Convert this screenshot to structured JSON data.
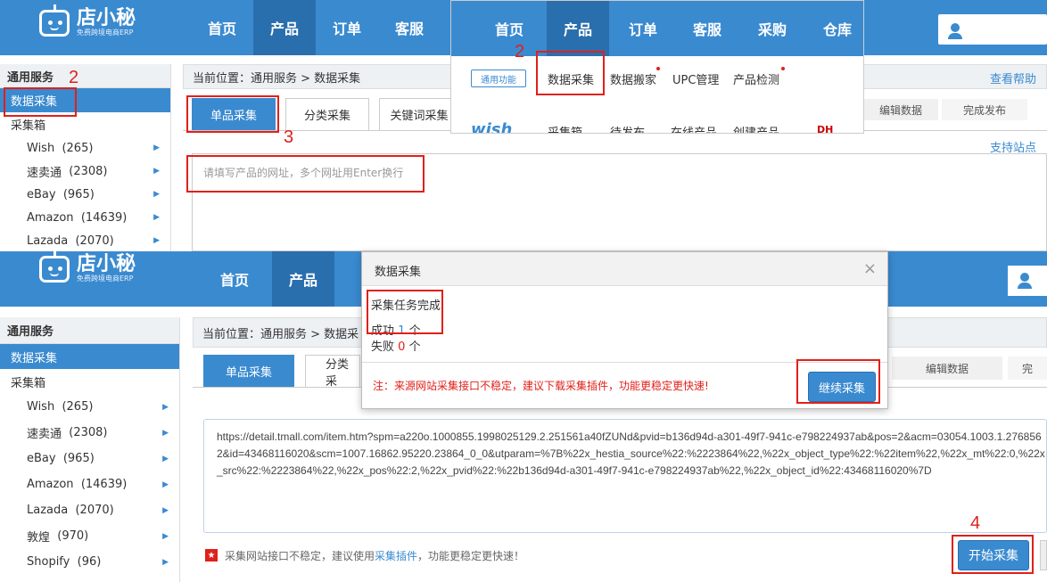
{
  "top": {
    "logo_name": "店小秘",
    "logo_sub": "免费跨境电商ERP",
    "nav": [
      "首页",
      "产品",
      "订单",
      "客服"
    ],
    "sidebar_header": "通用服务",
    "sidebar_selected": "数据采集",
    "sidebar_item": "采集箱",
    "sidebar_subs": [
      {
        "name": "Wish",
        "count": "(265)"
      },
      {
        "name": "速卖通",
        "count": "(2308)"
      },
      {
        "name": "eBay",
        "count": "(965)"
      },
      {
        "name": "Amazon",
        "count": "(14639)"
      },
      {
        "name": "Lazada",
        "count": "(2070)"
      }
    ],
    "breadcrumb_prefix": "当前位置：",
    "breadcrumb": "通用服务 > 数据采集",
    "tabs": [
      "单品采集",
      "分类采集",
      "关键词采集"
    ],
    "placeholder": "请填写产品的网址，多个网址用Enter换行",
    "help": "查看帮助",
    "steps": [
      "编辑数据",
      "完成发布"
    ],
    "support": "支持站点"
  },
  "dropdown": {
    "nav": [
      "首页",
      "产品",
      "订单",
      "客服",
      "采购",
      "仓库"
    ],
    "badge": "通用功能",
    "items": [
      "数据采集",
      "数据搬家",
      "UPC管理",
      "产品检测"
    ],
    "row2": [
      "采集箱",
      "待发布",
      "在线产品",
      "创建产品"
    ],
    "wish": "wish",
    "dh": "DH"
  },
  "bottom": {
    "logo_name": "店小秘",
    "logo_sub": "免费跨境电商ERP",
    "nav": [
      "首页",
      "产品"
    ],
    "sidebar_header": "通用服务",
    "sidebar_selected": "数据采集",
    "sidebar_item": "采集箱",
    "sidebar_subs": [
      {
        "name": "Wish",
        "count": "(265)"
      },
      {
        "name": "速卖通",
        "count": "(2308)"
      },
      {
        "name": "eBay",
        "count": "(965)"
      },
      {
        "name": "Amazon",
        "count": "(14639)"
      },
      {
        "name": "Lazada",
        "count": "(2070)"
      },
      {
        "name": "敦煌",
        "count": "(970)"
      },
      {
        "name": "Shopify",
        "count": "(96)"
      }
    ],
    "breadcrumb_prefix": "当前位置：",
    "breadcrumb": "通用服务 > 数据采",
    "tabs": [
      "单品采集",
      "分类采"
    ],
    "steps": [
      "编辑数据",
      "完"
    ],
    "url_text": "https://detail.tmall.com/item.htm?spm=a220o.1000855.1998025129.2.251561a40fZUNd&pvid=b136d94d-a301-49f7-941c-e798224937ab&pos=2&acm=03054.1003.1.2768562&id=43468116020&scm=1007.16862.95220.23864_0_0&utparam=%7B%22x_hestia_source%22:%2223864%22,%22x_object_type%22:%22item%22,%22x_mt%22:0,%22x_src%22:%2223864%22,%22x_pos%22:2,%22x_pvid%22:%22b136d94d-a301-49f7-941c-e798224937ab%22,%22x_object_id%22:43468116020%7D",
    "notice_prefix": "采集网站接口不稳定，建议使用",
    "notice_link": "采集插件",
    "notice_suffix": "，功能更稳定更快速！",
    "start_button": "开始采集"
  },
  "modal": {
    "title": "数据采集",
    "close": "×",
    "status": "采集任务完成",
    "success_label": "成功",
    "success_count": "1",
    "fail_label": "失败",
    "fail_count": "0",
    "unit": "个",
    "warning": "注：来源网站采集接口不稳定，建议下载采集插件，功能更稳定更快速!",
    "continue_button": "继续采集"
  },
  "annotations": [
    "2",
    "2",
    "3",
    "4"
  ],
  "colors": {
    "nav": "#3a8ad0",
    "nav_active": "#2a6fad",
    "highlight": "#e0201a"
  }
}
